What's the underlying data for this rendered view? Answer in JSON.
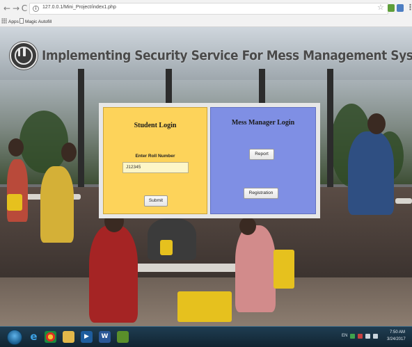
{
  "browser": {
    "url": "127.0.0.1/Mini_Project/index1.php",
    "bookmarks": [
      {
        "label": "Apps"
      },
      {
        "label": "Magic Autofill"
      }
    ]
  },
  "page": {
    "title": "Implementing Security Service For Mess Management System Using PHP."
  },
  "student_login": {
    "heading": "Student Login",
    "roll_label": "Enter Roll Number",
    "roll_value": "J12345",
    "submit_label": "Submit"
  },
  "mess_manager_login": {
    "heading": "Mess Manager Login",
    "report_label": "Report",
    "registration_label": "Registration"
  },
  "taskbar": {
    "language": "EN",
    "time": "7:50 AM",
    "date": "3/24/2017"
  },
  "colors": {
    "student_panel": "#fdd35a",
    "manager_panel": "#7f8fe4",
    "panel_frame": "#e7e7e7",
    "taskbar": "#1f3d52"
  }
}
